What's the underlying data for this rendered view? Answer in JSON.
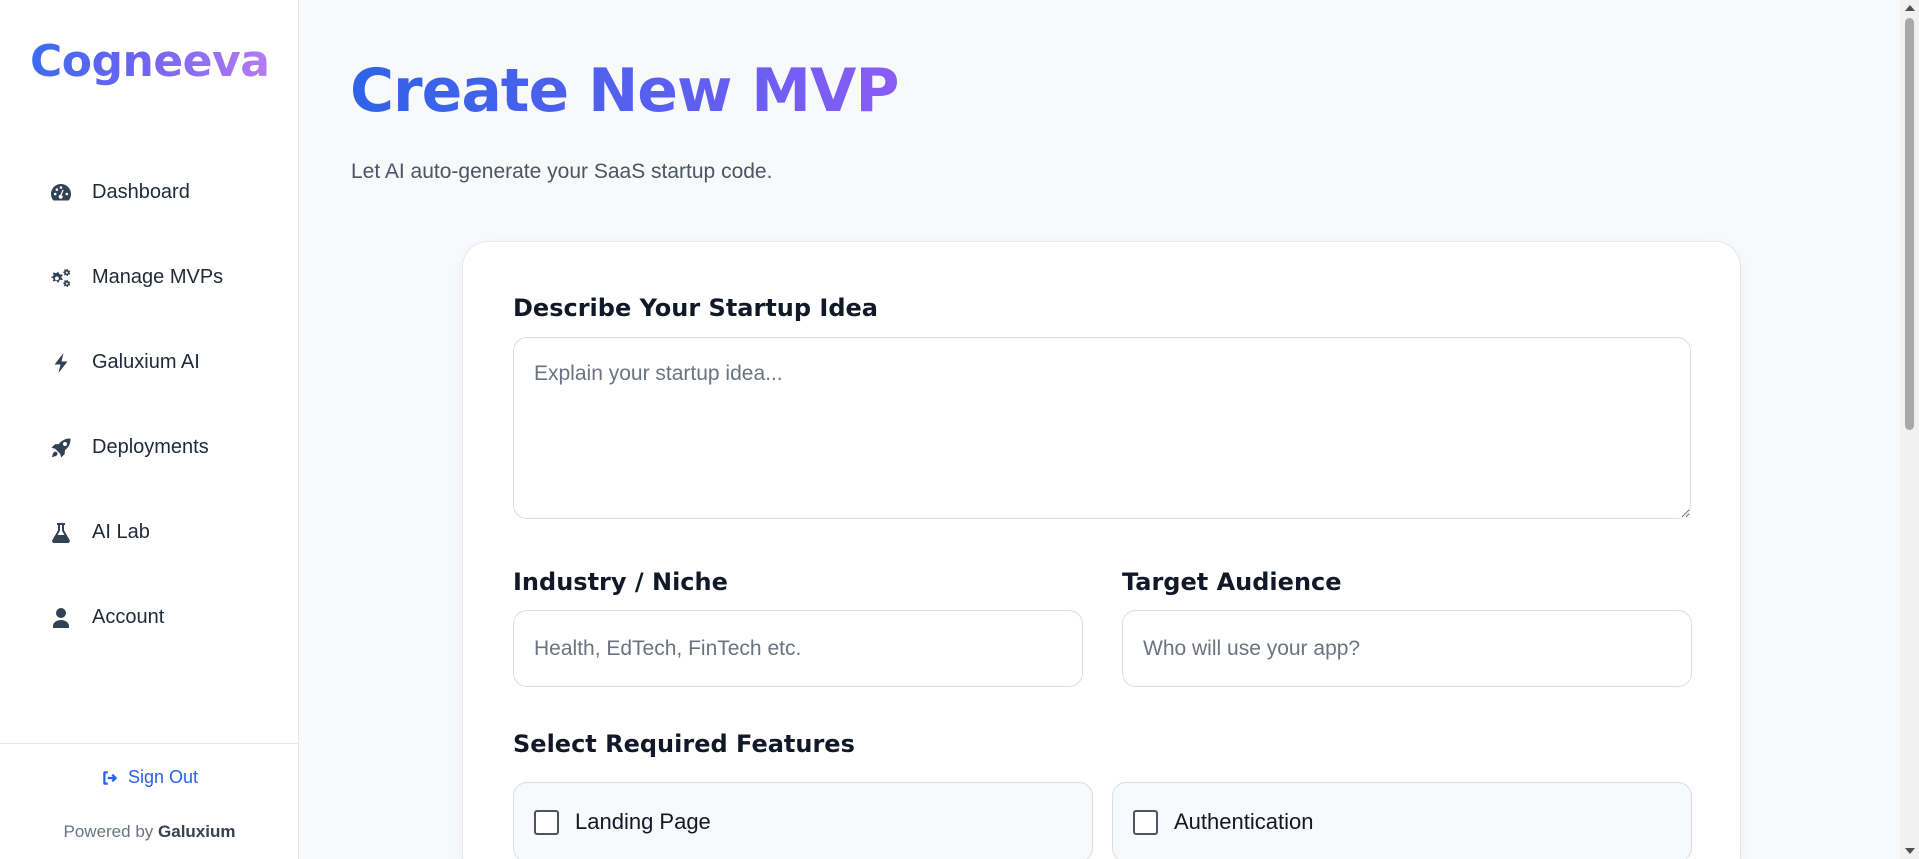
{
  "sidebar": {
    "logo": "Cogneeva",
    "items": [
      {
        "label": "Dashboard",
        "icon": "gauge-icon"
      },
      {
        "label": "Manage MVPs",
        "icon": "gears-icon"
      },
      {
        "label": "Galuxium AI",
        "icon": "bolt-icon"
      },
      {
        "label": "Deployments",
        "icon": "rocket-icon"
      },
      {
        "label": "AI Lab",
        "icon": "flask-icon"
      },
      {
        "label": "Account",
        "icon": "user-icon"
      }
    ],
    "signout_label": "Sign Out",
    "powered_prefix": "Powered by",
    "powered_brand": "Galuxium"
  },
  "main": {
    "title": "Create New MVP",
    "subtitle": "Let AI auto-generate your SaaS startup code."
  },
  "form": {
    "idea_label": "Describe Your Startup Idea",
    "idea_placeholder": "Explain your startup idea...",
    "industry_label": "Industry / Niche",
    "industry_placeholder": "Health, EdTech, FinTech etc.",
    "audience_label": "Target Audience",
    "audience_placeholder": "Who will use your app?",
    "features_label": "Select Required Features",
    "features": [
      {
        "label": "Landing Page",
        "checked": false
      },
      {
        "label": "Authentication",
        "checked": false
      }
    ]
  },
  "colors": {
    "accent": "#2563eb",
    "gradient_start": "#2f63e8",
    "gradient_end": "#8b5cf6"
  }
}
